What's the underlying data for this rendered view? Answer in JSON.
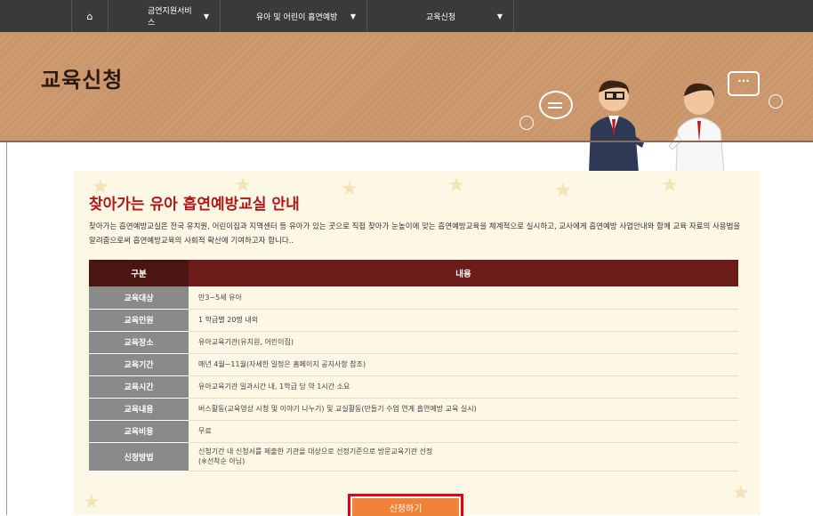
{
  "nav": {
    "home_icon": "home-icon",
    "items": [
      {
        "label": "금연지원서비스"
      },
      {
        "label": "유아 및 어린이 흡연예방"
      },
      {
        "label": "교육신청"
      }
    ]
  },
  "banner": {
    "title": "교육신청",
    "dots": "···"
  },
  "main": {
    "title": "찾아가는 유아 흡연예방교실 안내",
    "intro": "찾아가는 흡연예방교실은 전국 유치원, 어린이집과 지역센터 등 유아가 있는 곳으로 직접 찾아가 눈높이에 맞는 흡연예방교육을 체계적으로 실시하고, 교사에게 흡연예방 사업안내와 함께 교육 자료의 사용법을 알려줌으로써 흡연예방교육의 사회적 확산에 기여하고자 합니다.."
  },
  "table": {
    "headers": {
      "label": "구분",
      "content": "내용"
    },
    "rows": [
      {
        "label": "교육대상",
        "value": "만3~5세 유아"
      },
      {
        "label": "교육인원",
        "value": "1 학급별 20명 내외"
      },
      {
        "label": "교육장소",
        "value": "유아교육기관(유치원, 어린이집)"
      },
      {
        "label": "교육기간",
        "value": "매년 4월~11월(자세한 일정은 홈페이지 공지사항 참조)"
      },
      {
        "label": "교육시간",
        "value": "유아교육기관 일과시간 내, 1학급 당 약 1시간 소요"
      },
      {
        "label": "교육내용",
        "value": "버스활동(교육영상 시청 및 이야기 나누기) 및 교실활동(만들기 수업 연계 흡연예방 교육 실시)"
      },
      {
        "label": "교육비용",
        "value": "무료"
      },
      {
        "label": "신청방법",
        "value": "신청기간 내 신청서를 제출한 기관을 대상으로 선정기준으로 방문교육기관 선정",
        "value2": "(※선착순 아님)"
      }
    ]
  },
  "apply_button": {
    "label": "신청하기"
  },
  "colors": {
    "accent": "#b01818",
    "header": "#6b1c18",
    "button": "#f0823a",
    "highlight": "#e60012"
  }
}
